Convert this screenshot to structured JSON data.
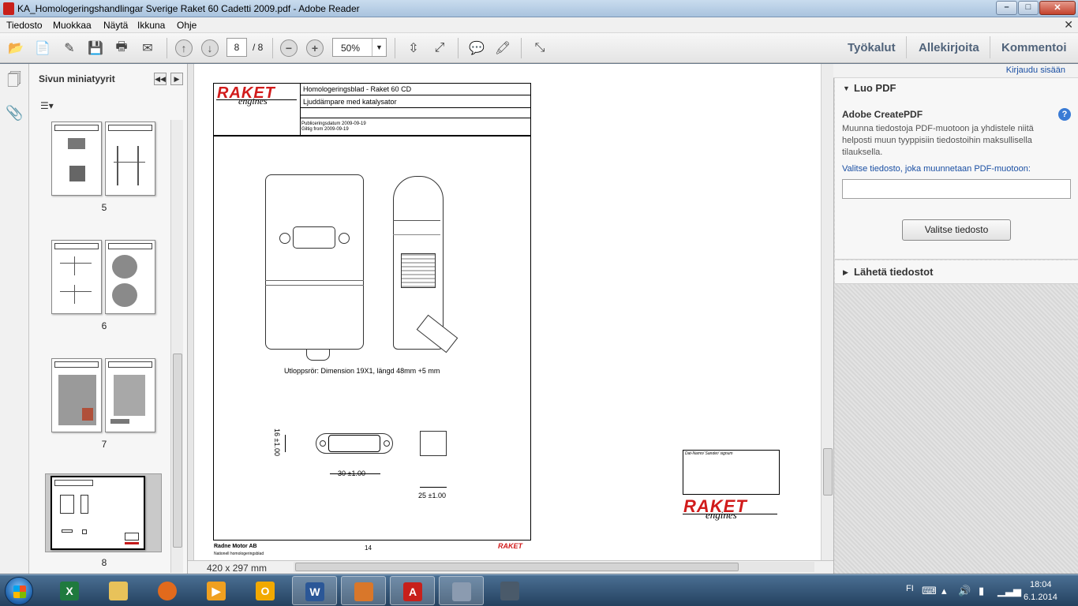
{
  "window": {
    "title": "KA_Homologeringshandlingar Sverige Raket 60 Cadetti 2009.pdf - Adobe Reader",
    "min": "–",
    "max": "□",
    "close": "✕"
  },
  "menu": {
    "items": [
      "Tiedosto",
      "Muokkaa",
      "Näytä",
      "Ikkuna",
      "Ohje"
    ],
    "close": "✕"
  },
  "toolbar": {
    "page_current": "8",
    "page_total": "/ 8",
    "zoom": "50%",
    "tabs": [
      "Työkalut",
      "Allekirjoita",
      "Kommentoi"
    ]
  },
  "sidebar": {
    "title": "Sivun miniatyyrit",
    "thumbnails": [
      {
        "label": "5"
      },
      {
        "label": "6"
      },
      {
        "label": "7"
      },
      {
        "label": "8",
        "selected": true
      }
    ]
  },
  "document": {
    "header_title": "Homologeringsblad - Raket 60 CD",
    "header_subtitle": "Ljuddämpare med katalysator",
    "pub_date": "Publiceringsdatum 2009-09-19",
    "valid_from": "Giltig from 2009-09-19",
    "note": "Utloppsrör: Dimension 19X1, längd 48mm +5 mm",
    "dim_height": "16 ±1.00",
    "dim_width": "30 ±1.00",
    "dim_square": "25 ±1.00",
    "sign_box_label": "Dat-Namn/ Sander/ signum",
    "footer_company": "Radne Motor AB",
    "footer_sub": "Nationell homologeringsblad",
    "footer_page": "14",
    "logo_text": "RAKET",
    "logo_sub": "engines"
  },
  "statusbar": {
    "page_size": "420 x 297 mm"
  },
  "rightpanel": {
    "login": "Kirjaudu sisään",
    "section1_title": "Luo PDF",
    "create_title": "Adobe CreatePDF",
    "create_desc": "Muunna tiedostoja PDF-muotoon ja yhdistele niitä helposti muun tyyppisiin tiedostoihin maksullisella tilauksella.",
    "select_label": "Valitse tiedosto, joka muunnetaan PDF-muotoon:",
    "select_button": "Valitse tiedosto",
    "section2_title": "Lähetä tiedostot"
  },
  "taskbar": {
    "lang": "FI",
    "time": "18:04",
    "date": "6.1.2014"
  },
  "colors": {
    "raket_red": "#d11b1b",
    "link_blue": "#1a4fa3",
    "tab_text": "#50637a"
  }
}
